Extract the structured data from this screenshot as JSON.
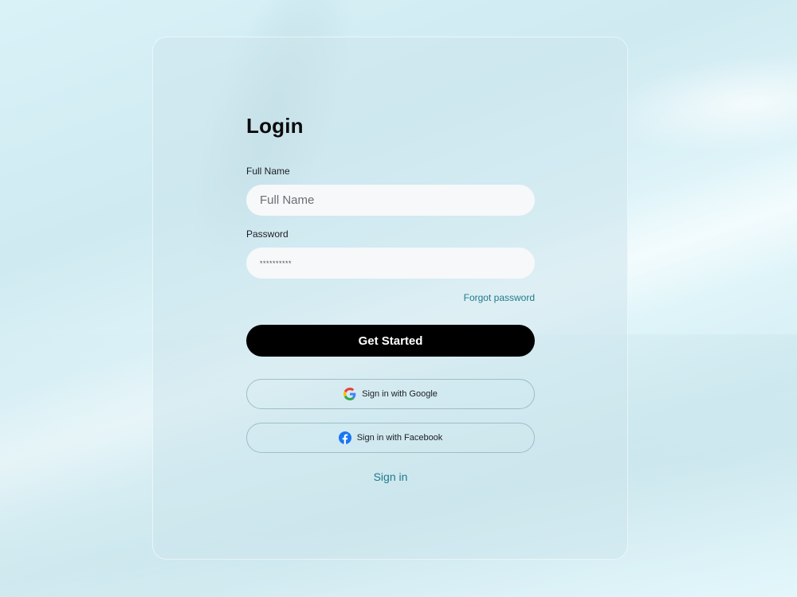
{
  "login": {
    "title": "Login",
    "full_name_label": "Full Name",
    "full_name_placeholder": "Full Name",
    "password_label": "Password",
    "password_value": "**********",
    "forgot_password": "Forgot password",
    "primary_button": "Get Started",
    "google_button": "Sign in with Google",
    "facebook_button": "Sign in with Facebook",
    "signin_link": "Sign in"
  },
  "icons": {
    "google": "google-icon",
    "facebook": "facebook-icon"
  },
  "colors": {
    "primary_button_bg": "#000000",
    "link": "#1f7a8c",
    "input_bg": "#f6f8fa",
    "facebook_blue": "#1877f2"
  }
}
